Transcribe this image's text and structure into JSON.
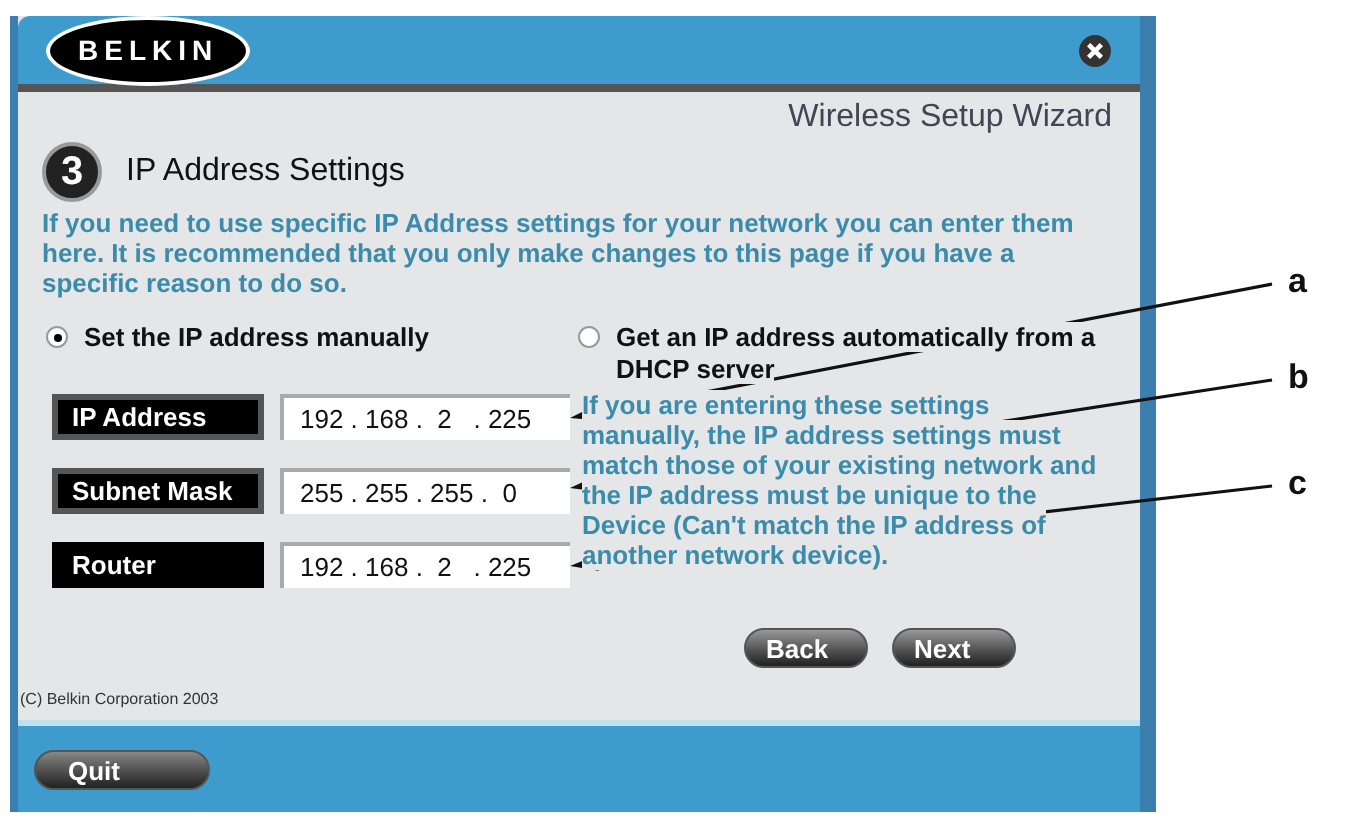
{
  "window": {
    "logo": "BELKIN",
    "subtitle": "Wireless Setup Wizard"
  },
  "step": {
    "number": "3",
    "title": "IP Address Settings"
  },
  "description": "If you need to use specific IP Address settings for your network you can enter them here. It is recommended that you only make changes to this page if you have a specific reason to do so.",
  "options": [
    {
      "label": "Set the IP address manually",
      "selected": true
    },
    {
      "label": "Get an IP address automatically from a DHCP server",
      "selected": false
    }
  ],
  "fields": [
    {
      "label": "IP Address",
      "value": "192 . 168 .  2   . 225",
      "framed": true
    },
    {
      "label": "Subnet Mask",
      "value": "255 . 255 . 255 .  0",
      "framed": true
    },
    {
      "label": "Router",
      "value": "192 . 168 .  2   . 225",
      "framed": false
    }
  ],
  "help": "If you are entering these settings manually, the IP address settings must match those of your existing network and the IP address must be unique to the Device (Can't match the IP address of another network device).",
  "buttons": [
    "Back",
    "Next"
  ],
  "copyright": "(C) Belkin Corporation 2003",
  "quit": "Quit",
  "callouts": [
    "a",
    "b",
    "c"
  ]
}
